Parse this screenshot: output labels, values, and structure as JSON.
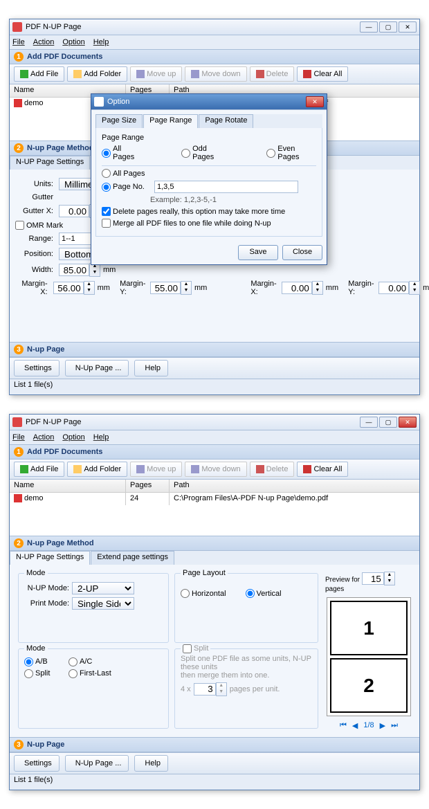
{
  "win": {
    "title": "PDF N-UP Page"
  },
  "menu": {
    "file": "File",
    "action": "Action",
    "option": "Option",
    "help": "Help"
  },
  "sec": {
    "add": "Add PDF Documents",
    "method": "N-up Page  Method",
    "nup": "N-up Page"
  },
  "tb": {
    "addfile": "Add File",
    "addfolder": "Add Folder",
    "moveup": "Move up",
    "movedown": "Move down",
    "delete": "Delete",
    "clearall": "Clear All"
  },
  "cols": {
    "name": "Name",
    "pages": "Pages",
    "path": "Path"
  },
  "file": {
    "name": "demo",
    "pages": "24",
    "path": "C:\\Program Files\\A-PDF N-up Page\\demo.pdf"
  },
  "tabs1": {
    "a": "N-UP Page Settings",
    "b": "Extend page settings"
  },
  "ext": {
    "units": "Units:",
    "units_v": "Millimeters",
    "gutter": "Gutter",
    "gutterx": "Gutter X:",
    "gutterx_v": "0.00",
    "mm": "mm",
    "omr": "OMR Mark",
    "range": "Range:",
    "range_v": "1--1",
    "position": "Position:",
    "position_v": "Bottom-Right",
    "width": "Width:",
    "width_v": "85.00",
    "marginx": "Margin-X:",
    "marginy": "Margin-Y:",
    "mx1": "56.00",
    "my1": "55.00",
    "mx2": "0.00",
    "my2": "0.00"
  },
  "preview": {
    "for": "Preview for",
    "pages": "pages",
    "v": "15",
    "pos": "1/8"
  },
  "bottom": {
    "settings": "Settings",
    "nup": "N-Up Page ...",
    "help": "Help"
  },
  "status": "List 1 file(s)",
  "dlg": {
    "title": "Option",
    "tabs": {
      "a": "Page Size",
      "b": "Page Range",
      "c": "Page Rotate"
    },
    "pr": "Page Range",
    "all": "All Pages",
    "odd": "Odd Pages",
    "even": "Even Pages",
    "pageno": "Page No.",
    "pageno_v": "1,3,5",
    "eg": "Example: 1,2,3-5,-1",
    "del": "Delete pages really, this option may take more time",
    "merge": "Merge all PDF files to one file while doing N-up",
    "save": "Save",
    "close": "Close"
  },
  "s2": {
    "mode": "Mode",
    "nupmode": "N-UP Mode:",
    "nupmode_v": "2-UP",
    "printmode": "Print Mode:",
    "printmode_v": "Single Sided",
    "layout": "Page Layout",
    "horiz": "Horizontal",
    "vert": "Vertical",
    "ab": "A/B",
    "ac": "A/C",
    "split": "Split",
    "firstlast": "First-Last",
    "splitlbl": "Split",
    "splittxt1": "Split one PDF file as some units, N-UP these units",
    "splittxt2": "then merge them into one.",
    "four": "4  x",
    "ppu": "pages per unit.",
    "three": "3"
  }
}
